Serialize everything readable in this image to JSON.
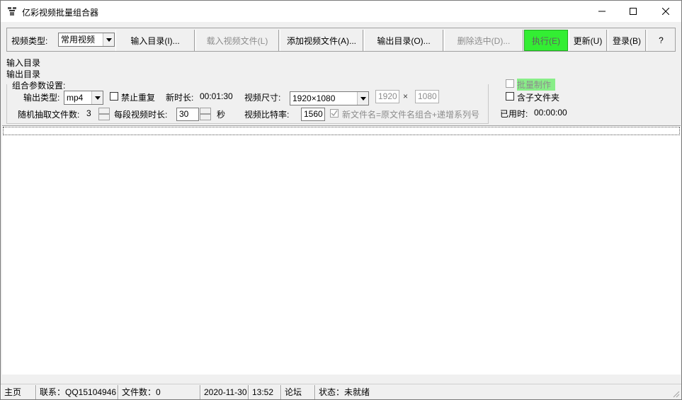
{
  "window": {
    "title": "亿彩视频批量组合器"
  },
  "toolbar": {
    "video_type_label": "视频类型:",
    "video_type_value": "常用视频",
    "buttons": {
      "input_dir": "输入目录(I)...",
      "load_video_files": "载入视频文件(L)",
      "add_video_files": "添加视频文件(A)...",
      "output_dir": "输出目录(O)...",
      "delete_selected": "删除选中(D)...",
      "execute": "执行(E)",
      "update": "更新(U)",
      "login": "登录(B)",
      "help": "?"
    }
  },
  "paths": {
    "input_dir_label": "输入目录",
    "output_dir_label": "输出目录"
  },
  "settings": {
    "group_title": "组合参数设置:",
    "output_type_label": "输出类型:",
    "output_type_value": "mp4",
    "no_repeat_label": "禁止重复",
    "new_duration_label": "新时长:",
    "new_duration_value": "00:01:30",
    "video_size_label": "视频尺寸:",
    "video_size_value": "1920×1080",
    "width_value": "1920",
    "times_sign": "×",
    "height_value": "1080",
    "random_files_label": "随机抽取文件数:",
    "random_files_value": "3",
    "segment_duration_label": "每段视频时长:",
    "segment_duration_value": "30",
    "seconds_unit": "秒",
    "bitrate_label": "视频比特率:",
    "bitrate_value": "1560",
    "new_filename_label": "新文件名=原文件名组合+递增系列号",
    "batch_label": "批量制作",
    "subfolder_label": "含子文件夹",
    "elapsed_label": "已用时:",
    "elapsed_value": "00:00:00"
  },
  "statusbar": {
    "home": "主页",
    "contact": "联系：QQ15104946",
    "file_count": "文件数：0",
    "date": "2020-11-30",
    "time": "13:52",
    "forum": "论坛",
    "status": "状态：未就绪"
  },
  "colors": {
    "run_button": "#33ee33",
    "batch_highlight": "#88ee88"
  }
}
